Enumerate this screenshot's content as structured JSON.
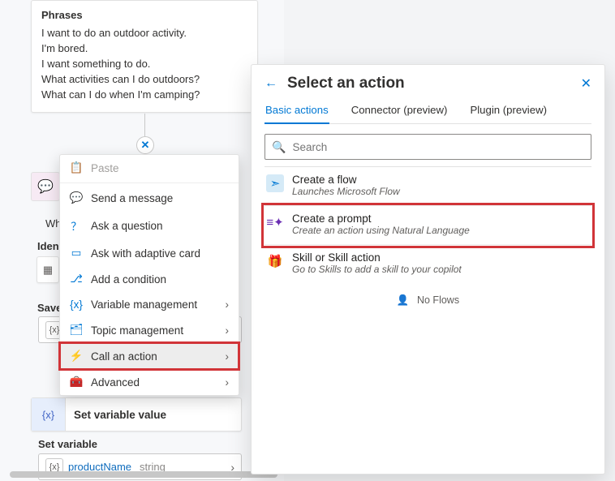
{
  "phrases_card": {
    "title": "Phrases",
    "items": [
      "I want to do an outdoor activity.",
      "I'm bored.",
      "I want something to do.",
      "What activities can I do outdoors?",
      "What can I do when I'm camping?"
    ]
  },
  "context_menu": {
    "paste": "Paste",
    "send_message": "Send a message",
    "ask_question": "Ask a question",
    "ask_adaptive": "Ask with adaptive card",
    "add_condition": "Add a condition",
    "variable_mgmt": "Variable management",
    "topic_mgmt": "Topic management",
    "call_action": "Call an action",
    "advanced": "Advanced"
  },
  "underlays": {
    "wh_text": "Wh",
    "identify_label": "Iden",
    "save_label": "Save"
  },
  "set_variable_node": {
    "header": "Set variable value",
    "section_label": "Set variable",
    "var_name": "productName",
    "var_type": "string"
  },
  "right_panel": {
    "title": "Select an action",
    "tabs": [
      "Basic actions",
      "Connector (preview)",
      "Plugin (preview)"
    ],
    "active_tab": 0,
    "search_placeholder": "Search",
    "items": [
      {
        "title": "Create a flow",
        "subtitle": "Launches Microsoft Flow",
        "icon": "flow"
      },
      {
        "title": "Create a prompt",
        "subtitle": "Create an action using Natural Language",
        "icon": "prompt",
        "highlight": true
      },
      {
        "title": "Skill or Skill action",
        "subtitle": "Go to Skills to add a skill to your copilot",
        "icon": "skill"
      }
    ],
    "empty_message": "No Flows"
  },
  "colors": {
    "accent": "#0078d4",
    "danger": "#d13438"
  }
}
